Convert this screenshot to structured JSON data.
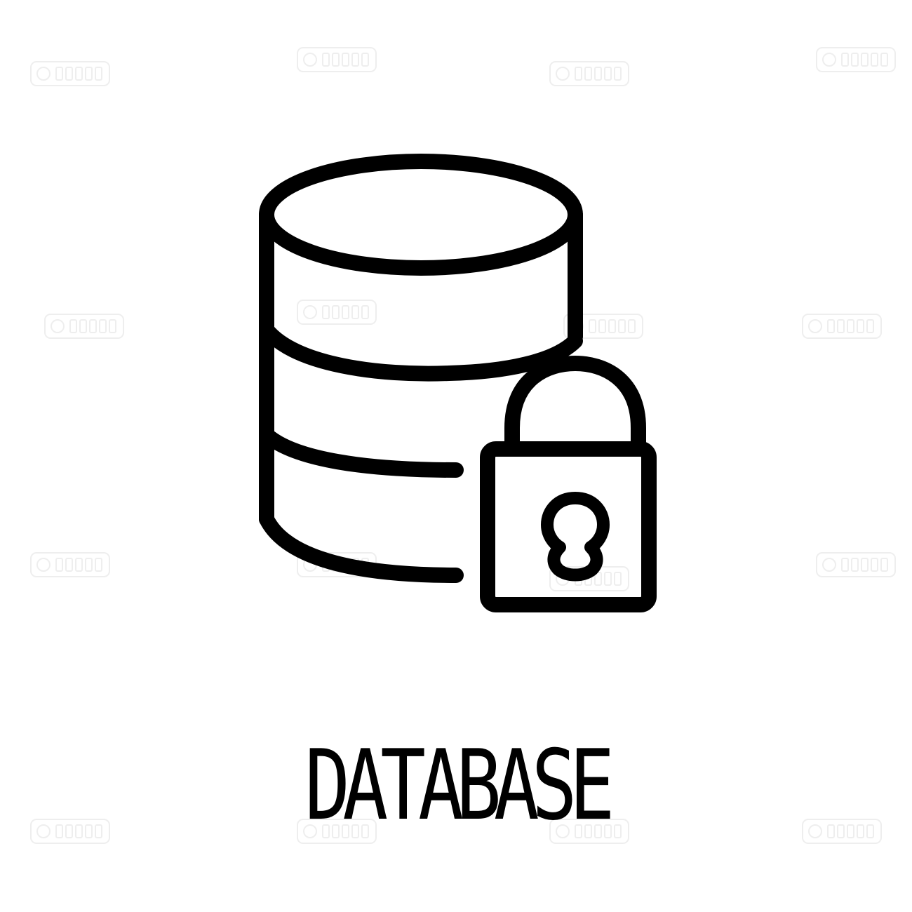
{
  "caption": {
    "text": "DATABASE"
  },
  "icon": {
    "name": "database-lock-icon",
    "stroke_color": "#000000"
  },
  "watermark": {
    "text": "123RF",
    "color": "#cfcfcf"
  }
}
